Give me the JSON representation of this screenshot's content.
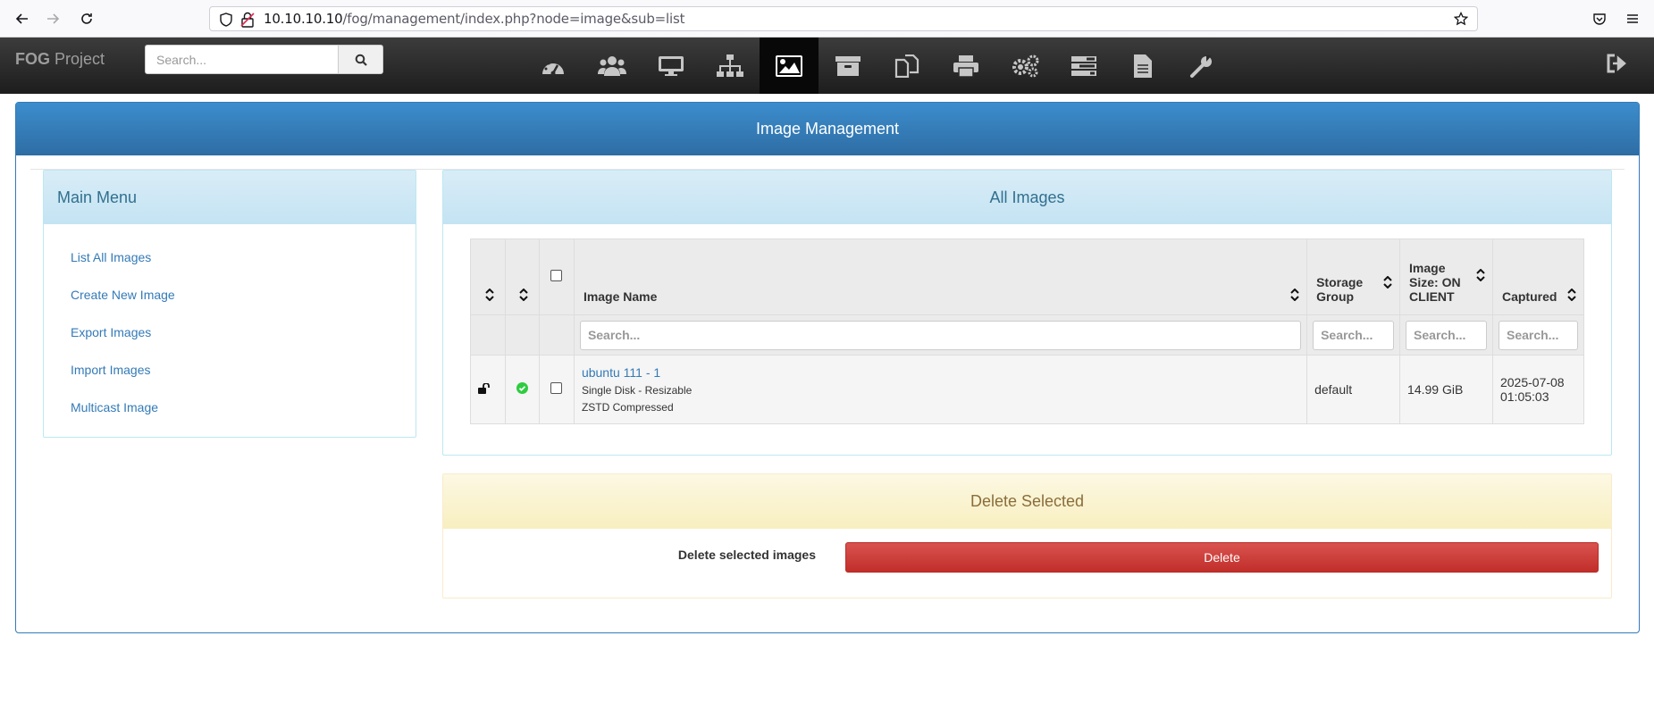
{
  "browser": {
    "url_host": "10.10.10.10",
    "url_path": "/fog/management/index.php?node=image&sub=list"
  },
  "navbar": {
    "brand_bold": "FOG",
    "brand_rest": " Project",
    "search_placeholder": "Search...",
    "icons": [
      "dashboard-icon",
      "users-icon",
      "desktop-icon",
      "sitemap-icon",
      "image-icon",
      "archive-icon",
      "copy-icon",
      "print-icon",
      "cogs-icon",
      "tasks-icon",
      "file-icon",
      "wrench-icon"
    ],
    "active_icon": "image-icon"
  },
  "page": {
    "title": "Image Management"
  },
  "main_menu": {
    "title": "Main Menu",
    "items": [
      {
        "label": "List All Images"
      },
      {
        "label": "Create New Image"
      },
      {
        "label": "Export Images"
      },
      {
        "label": "Import Images"
      },
      {
        "label": "Multicast Image"
      }
    ]
  },
  "images": {
    "title": "All Images",
    "columns": {
      "name": "Image Name",
      "storage_line1": "Storage",
      "storage_line2": "Group",
      "size_line1": "Image",
      "size_line2": "Size: ON",
      "size_line3": "CLIENT",
      "captured": "Captured"
    },
    "search_placeholder": "Search...",
    "rows": [
      {
        "name": "ubuntu 111 - 1",
        "type": "Single Disk - Resizable",
        "compression": "ZSTD Compressed",
        "storage_group": "default",
        "size": "14.99 GiB",
        "captured_date": "2025-07-08",
        "captured_time": "01:05:03"
      }
    ]
  },
  "delete_section": {
    "title": "Delete Selected",
    "label": "Delete selected images",
    "button": "Delete"
  },
  "colors": {
    "primary": "#337ab7",
    "danger": "#d9534f",
    "success": "#2ecc40"
  }
}
